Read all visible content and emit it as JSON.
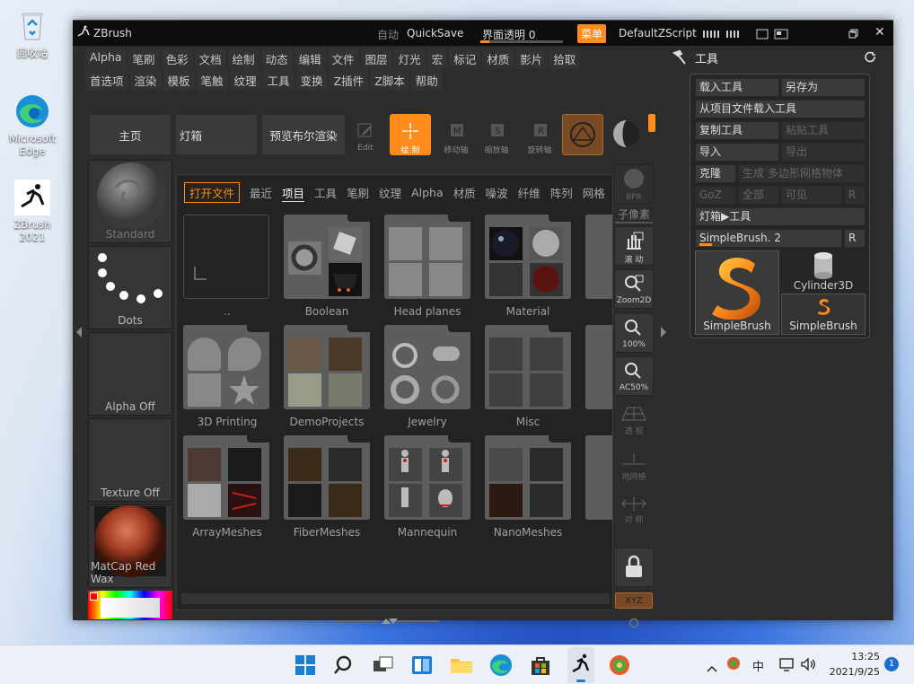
{
  "desktop": {
    "icons": [
      {
        "label": "回收站"
      },
      {
        "label": "Microsoft Edge"
      },
      {
        "label": "ZBrush 2021"
      }
    ]
  },
  "window": {
    "title": "ZBrush",
    "autosave": "自动",
    "quicksave": "QuickSave",
    "transparency": "界面透明 0",
    "menu_btn": "菜单",
    "zscript": "DefaultZScript"
  },
  "menus": {
    "row1": [
      "Alpha",
      "笔刷",
      "色彩",
      "文档",
      "绘制",
      "动态",
      "编辑",
      "文件",
      "图层",
      "灯光",
      "宏",
      "标记",
      "材质",
      "影片",
      "拾取"
    ],
    "row2": [
      "首选项",
      "渲染",
      "模板",
      "笔触",
      "纹理",
      "工具",
      "变换",
      "Z插件",
      "Z脚本",
      "帮助"
    ]
  },
  "shelf": {
    "home": "主页",
    "lightbox": "灯箱",
    "bpr_preview": "预览布尔渲染",
    "edit": "Edit",
    "draw": "绘 制",
    "move": "移动轴",
    "scale": "缩放轴",
    "rotate": "旋转轴"
  },
  "left": {
    "brush": "Standard",
    "stroke": "Dots",
    "alpha": "Alpha Off",
    "texture": "Texture Off",
    "material": "MatCap Red Wax"
  },
  "browser": {
    "tabs": [
      "打开文件",
      "最近",
      "项目",
      "工具",
      "笔刷",
      "纹理",
      "Alpha",
      "材质",
      "噪波",
      "纤维",
      "阵列",
      "网格"
    ],
    "active_tab": "项目",
    "folders": [
      {
        "name": ".."
      },
      {
        "name": "Boolean"
      },
      {
        "name": "Head planes"
      },
      {
        "name": "Material"
      },
      {
        "name": "3D Printing"
      },
      {
        "name": "DemoProjects"
      },
      {
        "name": "Jewelry"
      },
      {
        "name": "Misc"
      },
      {
        "name": "ArrayMeshes"
      },
      {
        "name": "FiberMeshes"
      },
      {
        "name": "Mannequin"
      },
      {
        "name": "NanoMeshes"
      }
    ]
  },
  "rightbar": {
    "bpr": "BPR",
    "subpixel": "子像素",
    "scroll": "滚 动",
    "zoom2d": "Zoom2D",
    "zoom100": "100%",
    "ac50": "AC50%",
    "persp": "透 视",
    "floor": "地网格",
    "sym": "对 称",
    "xyz": "XYZ"
  },
  "toolpanel": {
    "title": "工具",
    "load": "载入工具",
    "saveas": "另存为",
    "load_project": "从项目文件载入工具",
    "copy": "复制工具",
    "paste": "粘贴工具",
    "import": "导入",
    "export": "导出",
    "clone": "克隆",
    "make_polymesh": "生成 多边形网格物体",
    "goz": "GoZ",
    "all": "全部",
    "visible": "可见",
    "r": "R",
    "lightbox_tools": "灯箱▶工具",
    "current_tool": "SimpleBrush. 2",
    "tool1": "SimpleBrush",
    "tool2": "Cylinder3D",
    "tool3": "SimpleBrush"
  },
  "taskbar": {
    "ime": "中",
    "time": "13:25",
    "date": "2021/9/25",
    "badge": "1"
  }
}
